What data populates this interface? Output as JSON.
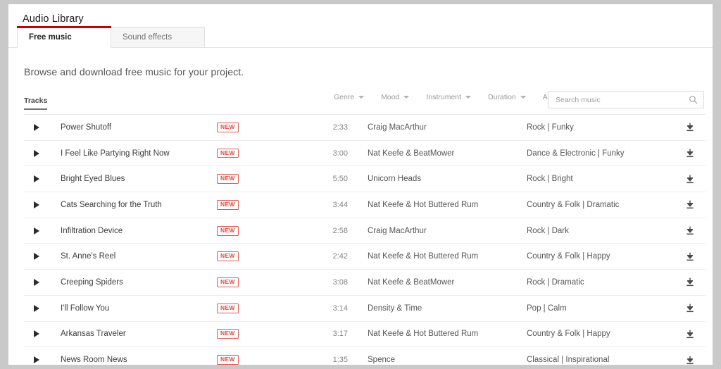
{
  "header": {
    "title": "Audio Library"
  },
  "tabs": [
    {
      "label": "Free music",
      "active": true,
      "name": "tab-free-music"
    },
    {
      "label": "Sound effects",
      "active": false,
      "name": "tab-sound-effects"
    }
  ],
  "intro": {
    "text": "Browse and download free music for your project."
  },
  "columns": {
    "tracks_label": "Tracks"
  },
  "filters": [
    {
      "label": "Genre",
      "name": "filter-genre"
    },
    {
      "label": "Mood",
      "name": "filter-mood"
    },
    {
      "label": "Instrument",
      "name": "filter-instrument"
    },
    {
      "label": "Duration",
      "name": "filter-duration"
    },
    {
      "label": "Attribution",
      "name": "filter-attribution"
    }
  ],
  "search": {
    "placeholder": "Search music",
    "value": "",
    "icon": "search-icon"
  },
  "badges": {
    "new_label": "NEW"
  },
  "icons": {
    "play": "play-icon",
    "download": "download-icon",
    "caret": "chevron-down-icon"
  },
  "colors": {
    "accent_red": "#cc0000",
    "badge_red": "#e04b42",
    "page_background": "#c9c9c9",
    "content_background": "#ffffff"
  },
  "tracks": [
    {
      "title": "Power Shutoff",
      "badge": "NEW",
      "duration": "2:33",
      "artist": "Craig MacArthur",
      "genre": "Rock | Funky"
    },
    {
      "title": "I Feel Like Partying Right Now",
      "badge": "NEW",
      "duration": "3:00",
      "artist": "Nat Keefe & BeatMower",
      "genre": "Dance & Electronic | Funky"
    },
    {
      "title": "Bright Eyed Blues",
      "badge": "NEW",
      "duration": "5:50",
      "artist": "Unicorn Heads",
      "genre": "Rock | Bright"
    },
    {
      "title": "Cats Searching for the Truth",
      "badge": "NEW",
      "duration": "3:44",
      "artist": "Nat Keefe & Hot Buttered Rum",
      "genre": "Country & Folk | Dramatic"
    },
    {
      "title": "Infiltration Device",
      "badge": "NEW",
      "duration": "2:58",
      "artist": "Craig MacArthur",
      "genre": "Rock | Dark"
    },
    {
      "title": "St. Anne's Reel",
      "badge": "NEW",
      "duration": "2:42",
      "artist": "Nat Keefe & Hot Buttered Rum",
      "genre": "Country & Folk | Happy"
    },
    {
      "title": "Creeping Spiders",
      "badge": "NEW",
      "duration": "3:08",
      "artist": "Nat Keefe & BeatMower",
      "genre": "Rock | Dramatic"
    },
    {
      "title": "I'll Follow You",
      "badge": "NEW",
      "duration": "3:14",
      "artist": "Density & Time",
      "genre": "Pop | Calm"
    },
    {
      "title": "Arkansas Traveler",
      "badge": "NEW",
      "duration": "3:17",
      "artist": "Nat Keefe & Hot Buttered Rum",
      "genre": "Country & Folk | Happy"
    },
    {
      "title": "News Room News",
      "badge": "NEW",
      "duration": "1:35",
      "artist": "Spence",
      "genre": "Classical | Inspirational"
    }
  ]
}
